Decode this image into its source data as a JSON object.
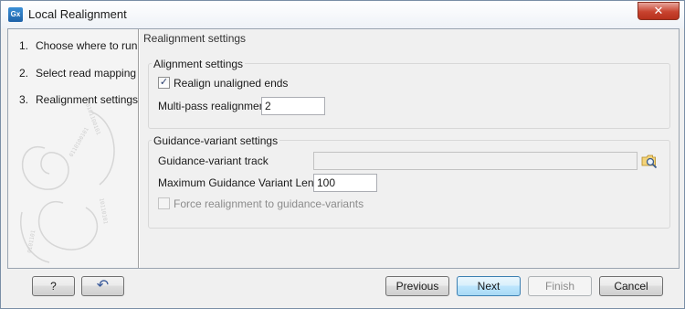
{
  "window": {
    "app_icon": "Gx",
    "title": "Local Realignment",
    "close_glyph": "✕"
  },
  "steps": [
    {
      "num": "1.",
      "label": "Choose where to run"
    },
    {
      "num": "2.",
      "label": "Select read mapping"
    },
    {
      "num": "3.",
      "label": "Realignment settings"
    }
  ],
  "main": {
    "title": "Realignment settings",
    "alignment_group": {
      "title": "Alignment settings",
      "realign_unaligned_ends": {
        "label": "Realign unaligned ends",
        "checked": true
      },
      "multi_pass": {
        "label": "Multi-pass realignment",
        "value": "2"
      }
    },
    "guidance_group": {
      "title": "Guidance-variant settings",
      "track": {
        "label": "Guidance-variant track",
        "value": ""
      },
      "max_length": {
        "label": "Maximum Guidance Variant Length",
        "value": "100"
      },
      "force": {
        "label": "Force realignment to guidance-variants",
        "checked": false
      }
    }
  },
  "footer": {
    "help_label": "?",
    "reset_glyph": "↶",
    "previous_label": "Previous",
    "next_label": "Next",
    "finish_label": "Finish",
    "cancel_label": "Cancel"
  },
  "icons": {
    "app": "app-icon",
    "close": "close-icon",
    "browse": "folder-browse-icon",
    "reset": "reset-icon",
    "help": "help-icon"
  }
}
